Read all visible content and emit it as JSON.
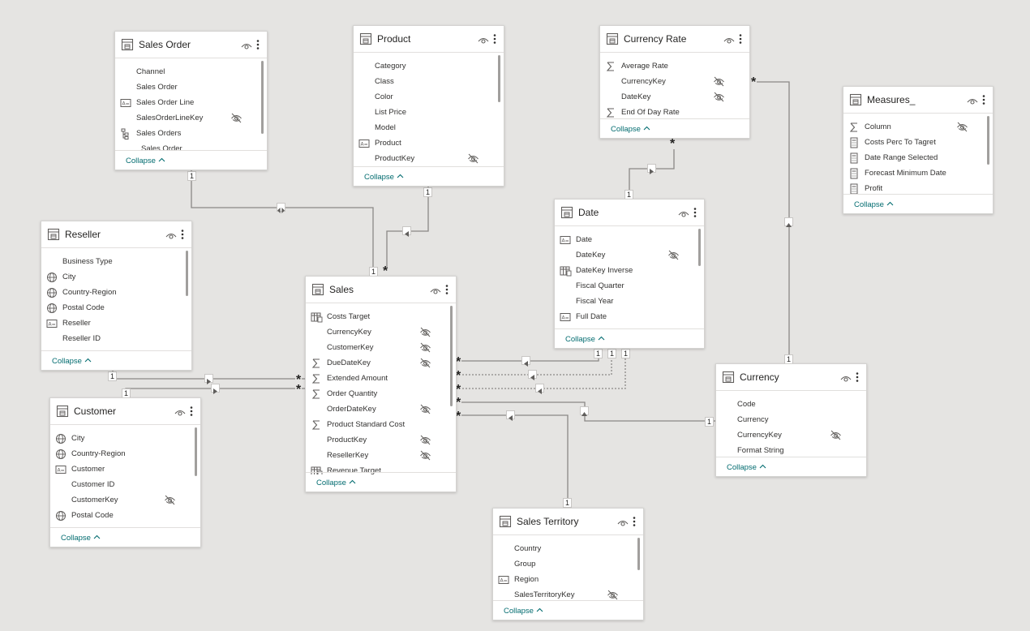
{
  "tables": [
    {
      "id": "sales-order",
      "name": "Sales Order",
      "fields": [
        {
          "name": "Channel",
          "icon": "none"
        },
        {
          "name": "Sales Order",
          "icon": "none"
        },
        {
          "name": "Sales Order Line",
          "icon": "text-icon"
        },
        {
          "name": "SalesOrderLineKey",
          "icon": "none",
          "hidden": true
        },
        {
          "name": "Sales Orders",
          "icon": "hierarchy-icon"
        },
        {
          "name": "Sales Order",
          "icon": "none",
          "sub": true
        }
      ],
      "collapse": "Collapse"
    },
    {
      "id": "product",
      "name": "Product",
      "fields": [
        {
          "name": "Category",
          "icon": "none"
        },
        {
          "name": "Class",
          "icon": "none"
        },
        {
          "name": "Color",
          "icon": "none"
        },
        {
          "name": "List Price",
          "icon": "none"
        },
        {
          "name": "Model",
          "icon": "none"
        },
        {
          "name": "Product",
          "icon": "text-icon"
        },
        {
          "name": "ProductKey",
          "icon": "none",
          "hidden": true
        }
      ],
      "collapse": "Collapse"
    },
    {
      "id": "currency-rate",
      "name": "Currency Rate",
      "fields": [
        {
          "name": "Average Rate",
          "icon": "sigma-icon"
        },
        {
          "name": "CurrencyKey",
          "icon": "none",
          "hidden": true
        },
        {
          "name": "DateKey",
          "icon": "none",
          "hidden": true
        },
        {
          "name": "End Of Day Rate",
          "icon": "sigma-icon"
        }
      ],
      "collapse": "Collapse"
    },
    {
      "id": "measures",
      "name": "Measures_",
      "fields": [
        {
          "name": "Column",
          "icon": "sigma-icon",
          "hidden": true
        },
        {
          "name": "Costs Perc To Tagret",
          "icon": "calculator-icon"
        },
        {
          "name": "Date Range Selected",
          "icon": "calculator-icon"
        },
        {
          "name": "Forecast Minimum Date",
          "icon": "calculator-icon"
        },
        {
          "name": "Profit",
          "icon": "calculator-icon"
        }
      ],
      "collapse": "Collapse"
    },
    {
      "id": "reseller",
      "name": "Reseller",
      "fields": [
        {
          "name": "Business Type",
          "icon": "none"
        },
        {
          "name": "City",
          "icon": "globe-icon"
        },
        {
          "name": "Country-Region",
          "icon": "globe-icon"
        },
        {
          "name": "Postal Code",
          "icon": "globe-icon"
        },
        {
          "name": "Reseller",
          "icon": "text-icon"
        },
        {
          "name": "Reseller ID",
          "icon": "none"
        }
      ],
      "collapse": "Collapse"
    },
    {
      "id": "date",
      "name": "Date",
      "fields": [
        {
          "name": "Date",
          "icon": "text-icon"
        },
        {
          "name": "DateKey",
          "icon": "none",
          "hidden": true
        },
        {
          "name": "DateKey Inverse",
          "icon": "calc-column-icon"
        },
        {
          "name": "Fiscal Quarter",
          "icon": "none"
        },
        {
          "name": "Fiscal Year",
          "icon": "none"
        },
        {
          "name": "Full Date",
          "icon": "text-icon"
        }
      ],
      "collapse": "Collapse"
    },
    {
      "id": "sales",
      "name": "Sales",
      "fields": [
        {
          "name": "Costs Target",
          "icon": "calc-column-icon"
        },
        {
          "name": "CurrencyKey",
          "icon": "none",
          "hidden": true
        },
        {
          "name": "CustomerKey",
          "icon": "none",
          "hidden": true
        },
        {
          "name": "DueDateKey",
          "icon": "sigma-icon",
          "hidden": true
        },
        {
          "name": "Extended Amount",
          "icon": "sigma-icon"
        },
        {
          "name": "Order Quantity",
          "icon": "sigma-icon"
        },
        {
          "name": "OrderDateKey",
          "icon": "none",
          "hidden": true
        },
        {
          "name": "Product Standard Cost",
          "icon": "sigma-icon"
        },
        {
          "name": "ProductKey",
          "icon": "none",
          "hidden": true
        },
        {
          "name": "ResellerKey",
          "icon": "none",
          "hidden": true
        },
        {
          "name": "Revenue Target",
          "icon": "calc-column-icon"
        }
      ],
      "collapse": "Collapse"
    },
    {
      "id": "currency",
      "name": "Currency",
      "fields": [
        {
          "name": "Code",
          "icon": "none"
        },
        {
          "name": "Currency",
          "icon": "none"
        },
        {
          "name": "CurrencyKey",
          "icon": "none",
          "hidden": true
        },
        {
          "name": "Format String",
          "icon": "none"
        }
      ],
      "collapse": "Collapse"
    },
    {
      "id": "customer",
      "name": "Customer",
      "fields": [
        {
          "name": "City",
          "icon": "globe-icon"
        },
        {
          "name": "Country-Region",
          "icon": "globe-icon"
        },
        {
          "name": "Customer",
          "icon": "text-icon"
        },
        {
          "name": "Customer ID",
          "icon": "none"
        },
        {
          "name": "CustomerKey",
          "icon": "none",
          "hidden": true
        },
        {
          "name": "Postal Code",
          "icon": "globe-icon"
        }
      ],
      "collapse": "Collapse"
    },
    {
      "id": "sales-territory",
      "name": "Sales Territory",
      "fields": [
        {
          "name": "Country",
          "icon": "none"
        },
        {
          "name": "Group",
          "icon": "none"
        },
        {
          "name": "Region",
          "icon": "text-icon"
        },
        {
          "name": "SalesTerritoryKey",
          "icon": "none",
          "hidden": true
        }
      ],
      "collapse": "Collapse"
    }
  ],
  "cardinality": {
    "one": "1",
    "many": "*"
  },
  "colors": {
    "canvas": "#e5e4e2",
    "line": "#8a8886",
    "link": "#036c70"
  }
}
